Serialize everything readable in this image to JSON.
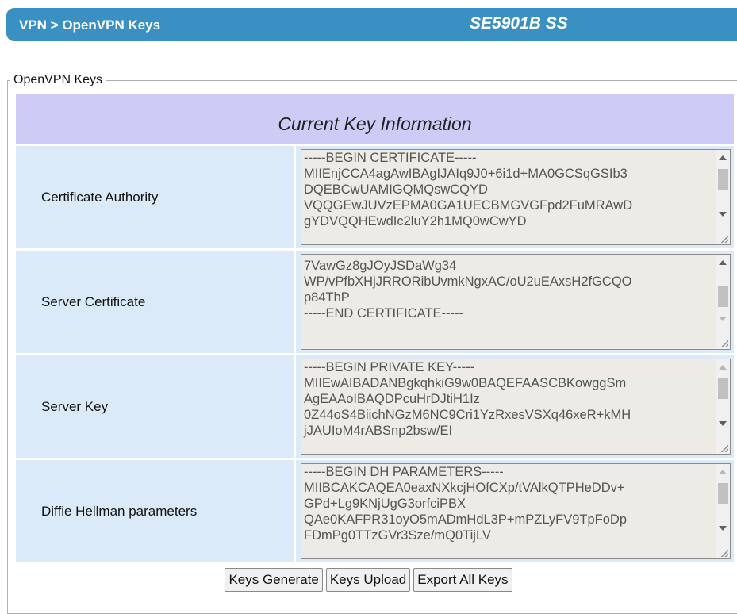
{
  "header": {
    "breadcrumb": "VPN > OpenVPN Keys",
    "model": "SE5901B SS"
  },
  "section_legend": "OpenVPN Keys",
  "table_title": "Current Key Information",
  "rows": [
    {
      "label": "Certificate Authority",
      "content": "-----BEGIN CERTIFICATE-----\nMIIEnjCCA4agAwIBAgIJAIq9J0+6i1d+MA0GCSqGSIb3\nDQEBCwUAMIGQMQswCQYD\nVQQGEwJUVzEPMA0GA1UECBMGVGFpd2FuMRAwD\ngYDVQQHEwdIc2luY2h1MQ0wCwYD"
    },
    {
      "label": "Server Certificate",
      "content": "7VawGz8gJOyJSDaWg34\nWP/vPfbXHjJRRORibUvmkNgxAC/oU2uEAxsH2fGCQO\np84ThP\n-----END CERTIFICATE-----"
    },
    {
      "label": "Server Key",
      "content": "-----BEGIN PRIVATE KEY-----\nMIIEwAIBADANBgkqhkiG9w0BAQEFAASCBKowggSm\nAgEAAoIBAQDPcuHrDJtiH1Iz\n0Z44oS4BiichNGzM6NC9Cri1YzRxesVSXq46xeR+kMH\njJAUIoM4rABSnp2bsw/EI"
    },
    {
      "label": "Diffie Hellman parameters",
      "content": "-----BEGIN DH PARAMETERS-----\nMIIBCAKCAQEA0eaxNXkcjHOfCXp/tVAlkQTPHeDDv+\nGPd+Lg9KNjUgG3orfciPBX\nQAe0KAFPR31oyO5mADmHdL3P+mPZLyFV9TpFoDp\nFDmPg0TTzGVr3Sze/mQ0TijLV"
    }
  ],
  "buttons": {
    "generate": "Keys Generate",
    "upload": "Keys Upload",
    "export": "Export All Keys"
  }
}
